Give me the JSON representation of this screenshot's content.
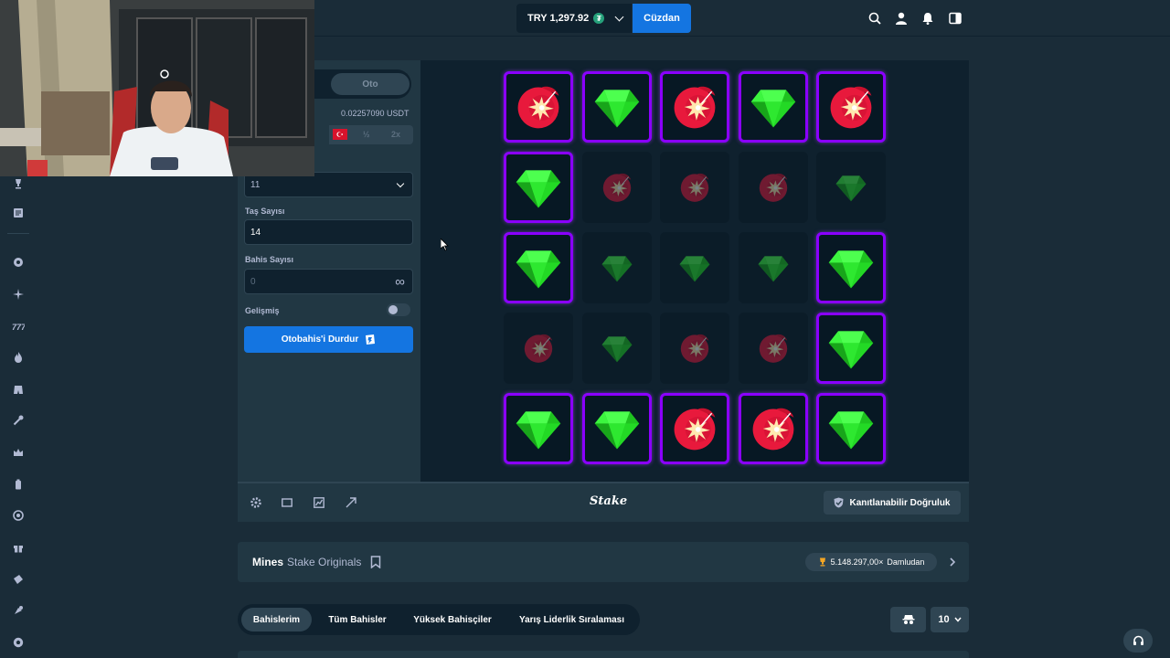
{
  "header": {
    "balance": "TRY 1,297.92",
    "currency_badge": "₮",
    "wallet_label": "Cüzdan",
    "icons": [
      "search-icon",
      "user-icon",
      "bell-icon",
      "sidebar-toggle-icon"
    ]
  },
  "bet_panel": {
    "mode_auto": "Oto",
    "amount_value": "0.02257090 USDT",
    "half_label": "½",
    "double_label": "2x",
    "mines_select_value": "11",
    "gems_label": "Taş Sayısı",
    "gems_value": "14",
    "bet_count_label": "Bahis Sayısı",
    "bet_count_value": "0",
    "infinity_symbol": "∞",
    "advanced_label": "Gelişmiş",
    "advanced_enabled": false,
    "stop_button_label": "Otobahis'i Durdur"
  },
  "board": {
    "grid": [
      [
        "mine",
        "gem",
        "mine",
        "gem",
        "mine"
      ],
      [
        "gem",
        "mine",
        "mine",
        "mine",
        "gem"
      ],
      [
        "gem",
        "gem",
        "gem",
        "gem",
        "gem"
      ],
      [
        "mine",
        "gem",
        "mine",
        "mine",
        "gem"
      ],
      [
        "gem",
        "gem",
        "mine",
        "mine",
        "gem"
      ]
    ],
    "revealed": [
      [
        true,
        true,
        true,
        true,
        true
      ],
      [
        true,
        false,
        false,
        false,
        false
      ],
      [
        true,
        false,
        false,
        false,
        true
      ],
      [
        false,
        false,
        false,
        false,
        true
      ],
      [
        true,
        true,
        true,
        true,
        true
      ]
    ]
  },
  "game_footer": {
    "brand": "Stake",
    "fairness_label": "Kanıtlanabilir Doğruluk"
  },
  "game_info": {
    "title": "Mines",
    "subtitle": "Stake Originals",
    "max_win": "5.148.297,00×",
    "max_win_suffix": "Damludan"
  },
  "bets_tabs": {
    "tabs": [
      "Bahislerim",
      "Tüm Bahisler",
      "Yüksek Bahisçiler",
      "Yarış Liderlik Sıralaması"
    ],
    "active_index": 0,
    "page_size": "10"
  },
  "colors": {
    "accent_blue": "#1475e1",
    "tile_border": "#8a00ff",
    "gem_green": "#2ee830",
    "mine_red": "#e8193c"
  }
}
